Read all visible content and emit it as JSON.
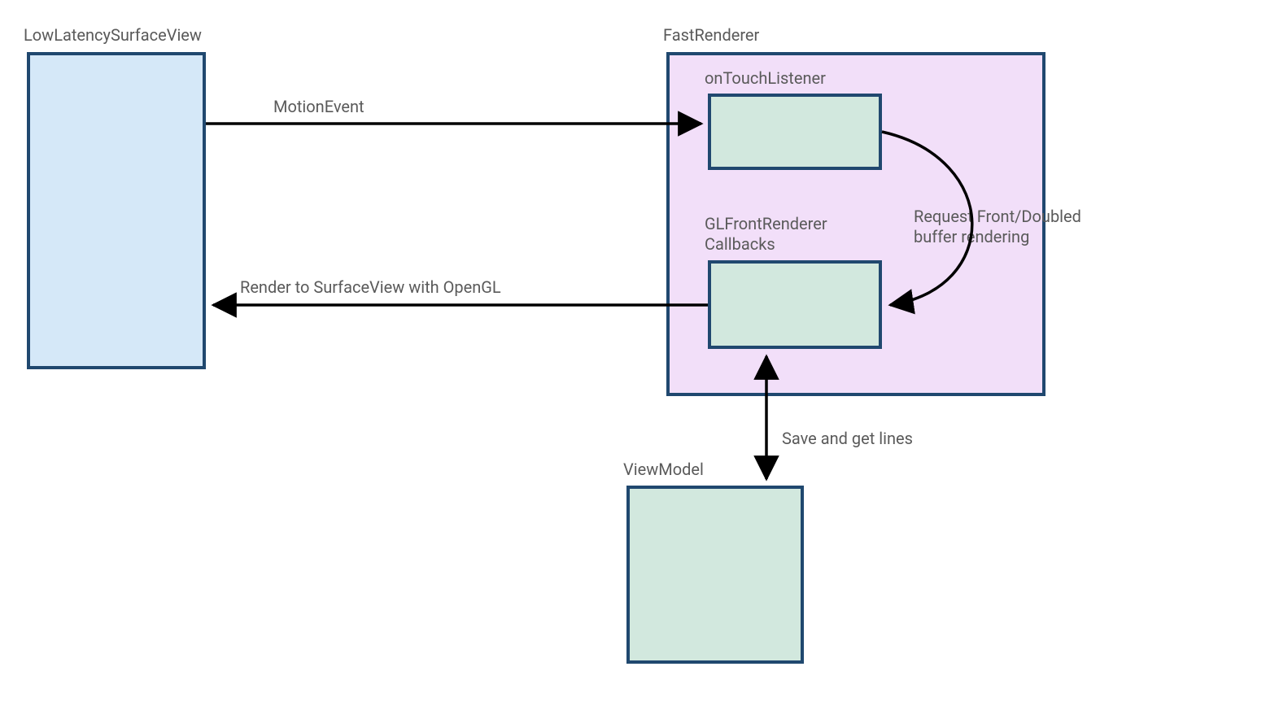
{
  "nodes": {
    "lowLatency": {
      "label": "LowLatencySurfaceView"
    },
    "fastRenderer": {
      "label": "FastRenderer"
    },
    "onTouch": {
      "label": "onTouchListener"
    },
    "glFront": {
      "label": "GLFrontRenderer\nCallbacks"
    },
    "viewModel": {
      "label": "ViewModel"
    }
  },
  "edges": {
    "motionEvent": {
      "label": "MotionEvent"
    },
    "renderOpenGL": {
      "label": "Render to SurfaceView with OpenGL"
    },
    "frontBuffer": {
      "label": "Request Front/Doubled\nbuffer rendering"
    },
    "saveGetLines": {
      "label": "Save and get lines"
    }
  }
}
